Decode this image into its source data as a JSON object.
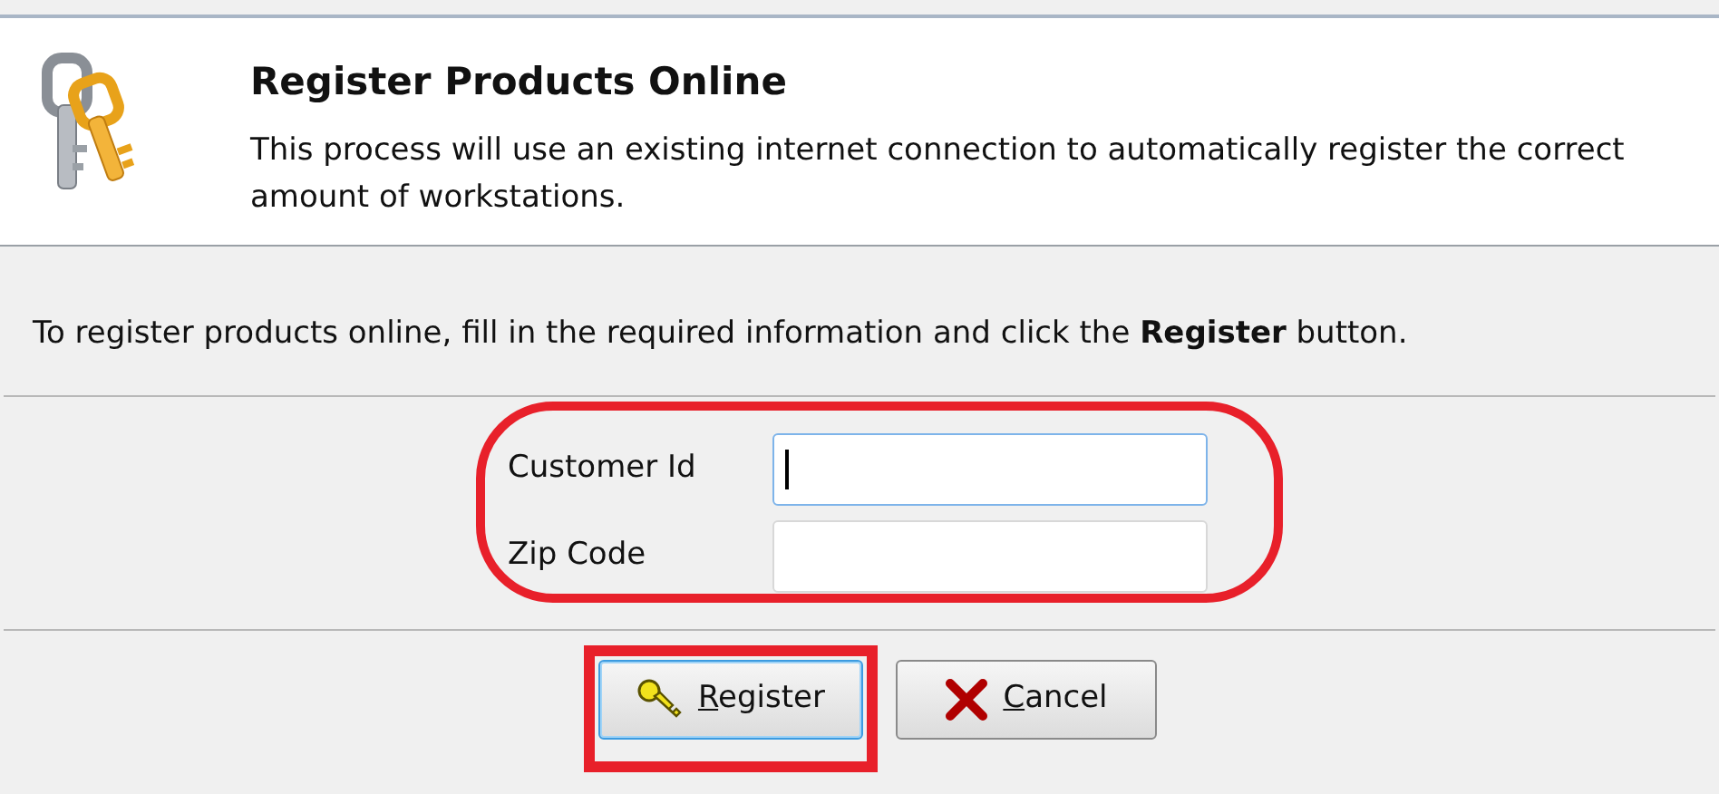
{
  "header": {
    "title": "Register Products Online",
    "description": "This process will use an existing internet connection to automatically register the correct amount of workstations."
  },
  "instruction": "To register products online, fill in the required information and click the **Register** button.",
  "form": {
    "highlighted": true,
    "fields": [
      {
        "label": "Customer Id",
        "focused": true
      },
      {
        "label": "Zip Code",
        "focused": false
      }
    ]
  },
  "buttons": [
    {
      "kind": "register",
      "mnemonic": "R",
      "label_rest": "egister",
      "focused": true,
      "highlighted": true
    },
    {
      "kind": "cancel",
      "mnemonic": "C",
      "label_rest": "ancel",
      "focused": false,
      "highlighted": false
    }
  ]
}
